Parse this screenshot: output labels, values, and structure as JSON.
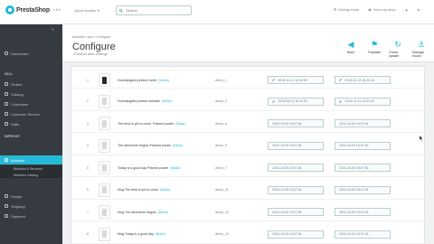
{
  "topbar": {
    "brand": "PrestaShop",
    "version": "1.6.1",
    "quick_access": "Quick Access",
    "search_placeholder": "Search",
    "debug_mode": "Debug mode",
    "view_shop": "View my shop"
  },
  "sidebar": {
    "dashboard": "Dashboard",
    "sell_header": "SELL",
    "sell_items": [
      "Orders",
      "Catalog",
      "Customers",
      "Customer Service",
      "Stats"
    ],
    "improve_header": "IMPROVE",
    "modules_label": "Modules",
    "modules_sub": [
      "Modules & Services",
      "Modules Catalog"
    ],
    "more_items": [
      "Design",
      "Shipping",
      "Payment"
    ]
  },
  "header": {
    "breadcrumb": "Modules  /  psrc  /  Configure",
    "title": "Configure",
    "subtitle": "Product date change",
    "tools": [
      "Back",
      "Translate",
      "Check update",
      "Manage hooks"
    ]
  },
  "table": {
    "rows": [
      {
        "num": "1",
        "name": "Hummingbird printed t-shirt",
        "tag": "(White)",
        "slot": "demo_1",
        "date1": "2016-10-12 16:10:59",
        "date2": "2016-10-12 16:22:44",
        "checked1": true,
        "checked2": true,
        "dark": true
      },
      {
        "num": "2",
        "name": "Hummingbird printed sweater",
        "tag": "(White)",
        "slot": "demo_3",
        "date1": "2016-05-01 16:10:50",
        "date2": "2016-12-31 14:22:44",
        "checked1": true,
        "checked2": true,
        "dark": false
      },
      {
        "num": "3",
        "name": "The best is yet to come' Framed poster",
        "tag": "(Black)",
        "slot": "demo_6",
        "date1": "2016-10-09 16:07:46",
        "date2": "2016-10-09 16:07:46",
        "checked1": false,
        "checked2": false,
        "dark": false
      },
      {
        "num": "4",
        "name": "The adventure begins Framed poster",
        "tag": "(Black)",
        "slot": "demo_5",
        "date1": "2016-10-09 16:07:46",
        "date2": "2016-10-09 16:07:46",
        "checked1": false,
        "checked2": false,
        "dark": false
      },
      {
        "num": "5",
        "name": "Today is a good day Framed poster",
        "tag": "(Black)",
        "slot": "demo_7",
        "date1": "2016-10-09 16:07:46",
        "date2": "2016-10-09 16:07:46",
        "checked1": false,
        "checked2": false,
        "dark": false
      },
      {
        "num": "6",
        "name": "Mug The best is yet to come",
        "tag": "(Black)",
        "slot": "demo_11",
        "date1": "2016-10-09 16:07:46",
        "date2": "2016-10-09 16:07:46",
        "checked1": false,
        "checked2": false,
        "dark": false
      },
      {
        "num": "7",
        "name": "Mug The adventure begins",
        "tag": "(Black)",
        "slot": "demo_13",
        "date1": "2016-10-09 16:07:46",
        "date2": "2016-10-09 16:07:46",
        "checked1": false,
        "checked2": false,
        "dark": false
      },
      {
        "num": "8",
        "name": "Mug Today is a good day",
        "tag": "(Black)",
        "slot": "demo_13",
        "date1": "2016-10-09 16:07:46",
        "date2": "2016-10-09 16:07:46",
        "checked1": false,
        "checked2": false,
        "dark": false
      }
    ]
  },
  "colors": {
    "accent": "#25b9d7",
    "sidebar": "#363a41",
    "text": "#363a41"
  }
}
